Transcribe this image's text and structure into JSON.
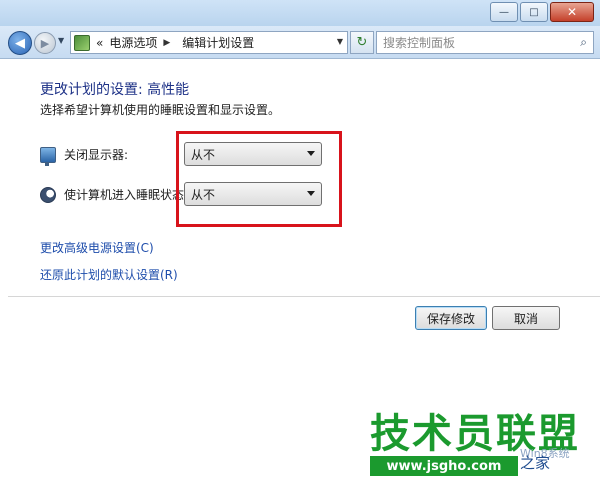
{
  "window": {
    "minimize_glyph": "—",
    "maximize_glyph": "□",
    "close_glyph": "✕"
  },
  "navigation": {
    "back_glyph": "◀",
    "forward_glyph": "▶",
    "history_glyph": "▼",
    "breadcrumb_prefix": "«",
    "breadcrumb": [
      "电源选项",
      "编辑计划设置"
    ],
    "breadcrumb_sep": "▶",
    "address_dropdown_glyph": "▼",
    "refresh_glyph": "↻",
    "search_placeholder": "搜索控制面板",
    "search_glyph": "⌕"
  },
  "page": {
    "title": "更改计划的设置: 高性能",
    "description": "选择希望计算机使用的睡眠设置和显示设置。"
  },
  "settings": [
    {
      "label": "关闭显示器:",
      "value": "从不",
      "icon": "monitor-icon"
    },
    {
      "label": "使计算机进入睡眠状态:",
      "value": "从不",
      "icon": "sleep-moon-icon"
    }
  ],
  "links": {
    "advanced": "更改高级电源设置(C)",
    "restore": "还原此计划的默认设置(R)"
  },
  "buttons": {
    "save": "保存修改",
    "cancel": "取消"
  },
  "watermark": {
    "title": "技术员联盟",
    "url": "www.jsgho.com",
    "site_suffix": "之家",
    "win_text": "Win8系统",
    "brand_color": "#1b9a2e"
  },
  "colors": {
    "highlight_border": "#d8131b",
    "title_color": "#1e3287",
    "link_color": "#1e4dab"
  }
}
